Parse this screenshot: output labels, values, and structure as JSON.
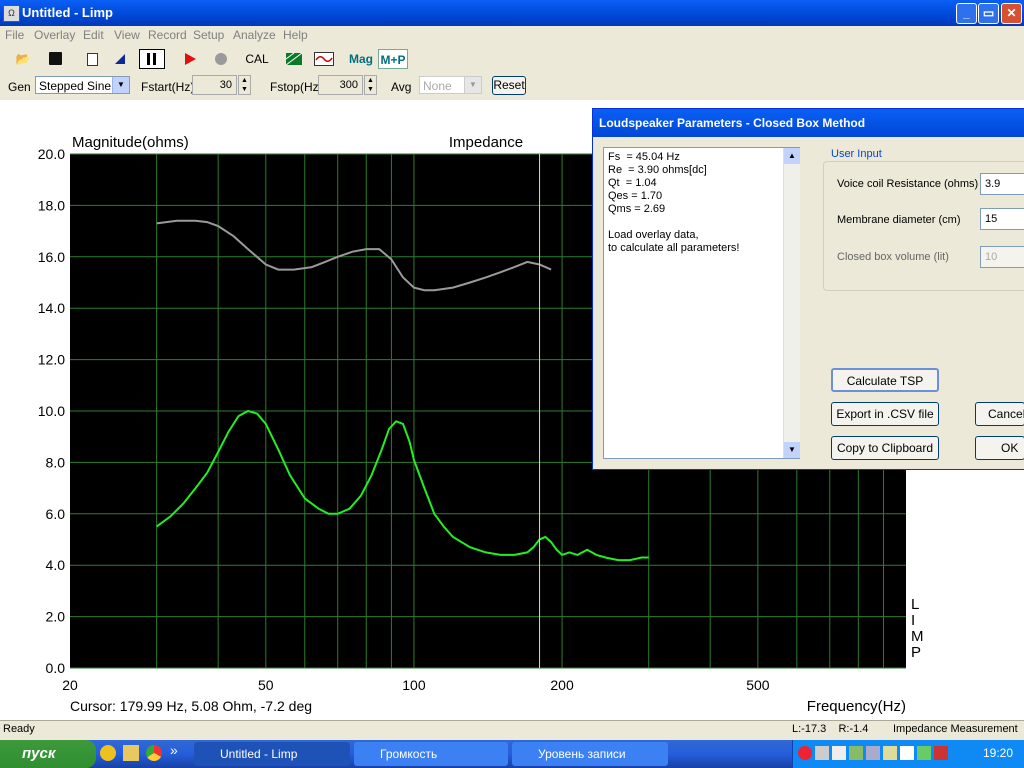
{
  "window": {
    "title": "Untitled - Limp",
    "min": "_",
    "max": "▭",
    "close": "✕"
  },
  "menu": [
    "File",
    "Overlay",
    "Edit",
    "View",
    "Record",
    "Setup",
    "Analyze",
    "Help"
  ],
  "toolbar": {
    "cal": "CAL",
    "mag": "Mag",
    "mp": "M+P"
  },
  "genrow": {
    "gen_label": "Gen",
    "gen_value": "Stepped Sine",
    "fstart_label": "Fstart(Hz)",
    "fstart_value": "30",
    "fstop_label": "Fstop(Hz)",
    "fstop_value": "300",
    "avg_label": "Avg",
    "avg_value": "None",
    "reset": "Reset"
  },
  "chart_data": {
    "type": "line",
    "title": "Impedance",
    "ylabel": "Magnitude(ohms)",
    "xlabel": "Frequency(Hz)",
    "xscale": "log",
    "xlim": [
      20,
      1000
    ],
    "ylim": [
      0,
      20
    ],
    "yticks": [
      "20.0",
      "18.0",
      "16.0",
      "14.0",
      "12.0",
      "10.0",
      "8.0",
      "6.0",
      "4.0",
      "2.0",
      "0.0"
    ],
    "xticks": [
      {
        "v": 20,
        "label": "20"
      },
      {
        "v": 50,
        "label": "50"
      },
      {
        "v": 100,
        "label": "100"
      },
      {
        "v": 200,
        "label": "200"
      },
      {
        "v": 500,
        "label": "500"
      }
    ],
    "cursor_x": 180,
    "cursor_text": "Cursor: 179.99 Hz, 5.08 Ohm, -7.2 deg",
    "side_label": "L\nI\nM\nP",
    "series": [
      {
        "color": "#9a9a9a",
        "x": [
          30,
          33,
          36,
          38,
          40,
          43,
          46,
          50,
          53,
          57,
          62,
          66,
          70,
          75,
          80,
          85,
          90,
          95,
          100,
          105,
          110,
          120,
          130,
          140,
          150,
          160,
          170,
          180,
          190
        ],
        "y": [
          17.3,
          17.4,
          17.4,
          17.35,
          17.2,
          16.8,
          16.3,
          15.7,
          15.5,
          15.5,
          15.6,
          15.8,
          16.0,
          16.2,
          16.3,
          16.3,
          15.9,
          15.2,
          14.8,
          14.7,
          14.7,
          14.8,
          15.0,
          15.2,
          15.4,
          15.6,
          15.8,
          15.7,
          15.5
        ]
      },
      {
        "color": "#22ee22",
        "x": [
          30,
          32,
          34,
          36,
          38,
          40,
          42,
          44,
          46,
          48,
          50,
          53,
          56,
          60,
          64,
          67,
          70,
          74,
          78,
          82,
          86,
          89,
          92,
          95,
          98,
          100,
          105,
          110,
          115,
          120,
          130,
          140,
          150,
          160,
          170,
          175,
          180,
          185,
          190,
          195,
          200,
          207,
          215,
          225,
          235,
          245,
          260,
          275,
          290,
          300
        ],
        "y": [
          5.5,
          5.9,
          6.4,
          7.0,
          7.6,
          8.4,
          9.2,
          9.8,
          10.0,
          9.9,
          9.5,
          8.5,
          7.5,
          6.6,
          6.2,
          6.0,
          6.0,
          6.2,
          6.7,
          7.5,
          8.5,
          9.3,
          9.6,
          9.5,
          8.8,
          8.1,
          7.0,
          6.0,
          5.5,
          5.1,
          4.7,
          4.5,
          4.4,
          4.4,
          4.5,
          4.7,
          5.0,
          5.1,
          4.9,
          4.6,
          4.4,
          4.5,
          4.4,
          4.6,
          4.4,
          4.3,
          4.2,
          4.2,
          4.3,
          4.3
        ]
      }
    ]
  },
  "dialog": {
    "title": "Loudspeaker Parameters - Closed Box Method",
    "results": "Fs  = 45.04 Hz\nRe  = 3.90 ohms[dc]\nQt  = 1.04\nQes = 1.70\nQms = 2.69\n\nLoad overlay data,\nto calculate all parameters!",
    "group_label": "User Input",
    "vc_label": "Voice coil Resistance (ohms)",
    "vc_value": "3.9",
    "md_label": "Membrane diameter (cm)",
    "md_value": "15",
    "cb_label": "Closed box volume (lit)",
    "cb_value": "10",
    "calc": "Calculate TSP",
    "export": "Export in .CSV file",
    "copy": "Copy to Clipboard",
    "cancel": "Cancel",
    "ok": "OK"
  },
  "status": {
    "left": "Ready",
    "lr": "L:-17.3    R:-1.4",
    "right": "Impedance Measurement"
  },
  "taskbar": {
    "start": "пуск",
    "task1": "Untitled - Limp",
    "task2": "Громкость",
    "task3": "Уровень записи",
    "clock": "19:20"
  }
}
